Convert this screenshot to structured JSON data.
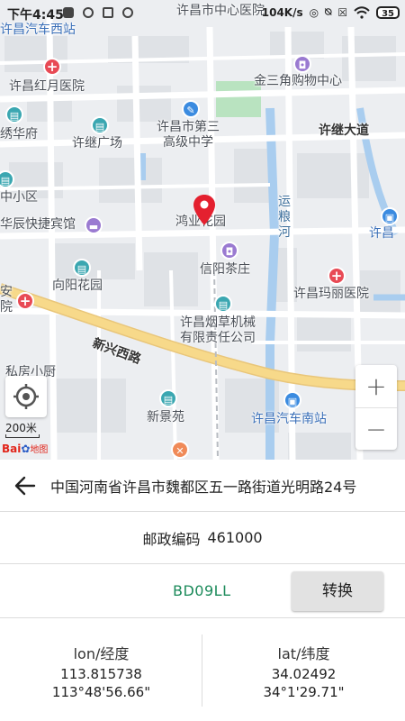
{
  "status_bar": {
    "time": "下午4:45",
    "speed": "104K/s",
    "battery": "35",
    "icons": [
      "notification-square-icon",
      "circle-icon",
      "mail-icon",
      "circle-icon",
      "location-icon",
      "alarm-off-icon",
      "sim-blocked-icon",
      "wifi-icon",
      "battery-icon"
    ]
  },
  "map": {
    "pois": {
      "bus_west": "许昌汽车西站",
      "center_hospital": "许昌市中心医院",
      "hongye_hospital": "许昌红月医院",
      "sanjiao_mall": "金三角购物中心",
      "xiuhua": "绣华府",
      "xuji_square": "许继广场",
      "school": "许昌市第三\n高级中学",
      "xuji_road": "许继大道",
      "xiaoqu": "中小区",
      "huachen_hotel": "华辰快捷宾馆",
      "hongye_garden": "鸿业花园",
      "canal": "运\n粮\n河",
      "xuchang_right": "许昌",
      "xinyang_tea": "信阳茶庄",
      "an_yuan": "安\n院",
      "xiangyang_garden": "向阳花园",
      "mali_hospital": "许昌玛丽医院",
      "xinxing_road": "新兴西路",
      "tobacco": "许昌烟草机械\n有限责任公司",
      "kitchen": "私房小厨",
      "xinjingyuan": "新景苑",
      "bus_south": "许昌汽车南站"
    },
    "scale": "200米",
    "logo": "Bai",
    "logo_map": "地图",
    "zoom_in": "+",
    "zoom_out": "−"
  },
  "panel": {
    "address": "中国河南省许昌市魏都区五一路街道光明路24号",
    "zip_label": "邮政编码",
    "zip_value": "461000",
    "coord_system": "BD09LL",
    "convert_label": "转换",
    "lon_title": "lon/经度",
    "lon_decimal": "113.815738",
    "lon_dms": "113°48'56.66\"",
    "lat_title": "lat/纬度",
    "lat_decimal": "34.02492",
    "lat_dms": "34°1'29.71\""
  },
  "colors": {
    "map_bg": "#eceef1",
    "main_road": "#f7d98a",
    "canal": "#a9cdef",
    "park": "#b9e3c0",
    "pin": "#e4202f",
    "coord_system_text": "#1b8a5a"
  }
}
